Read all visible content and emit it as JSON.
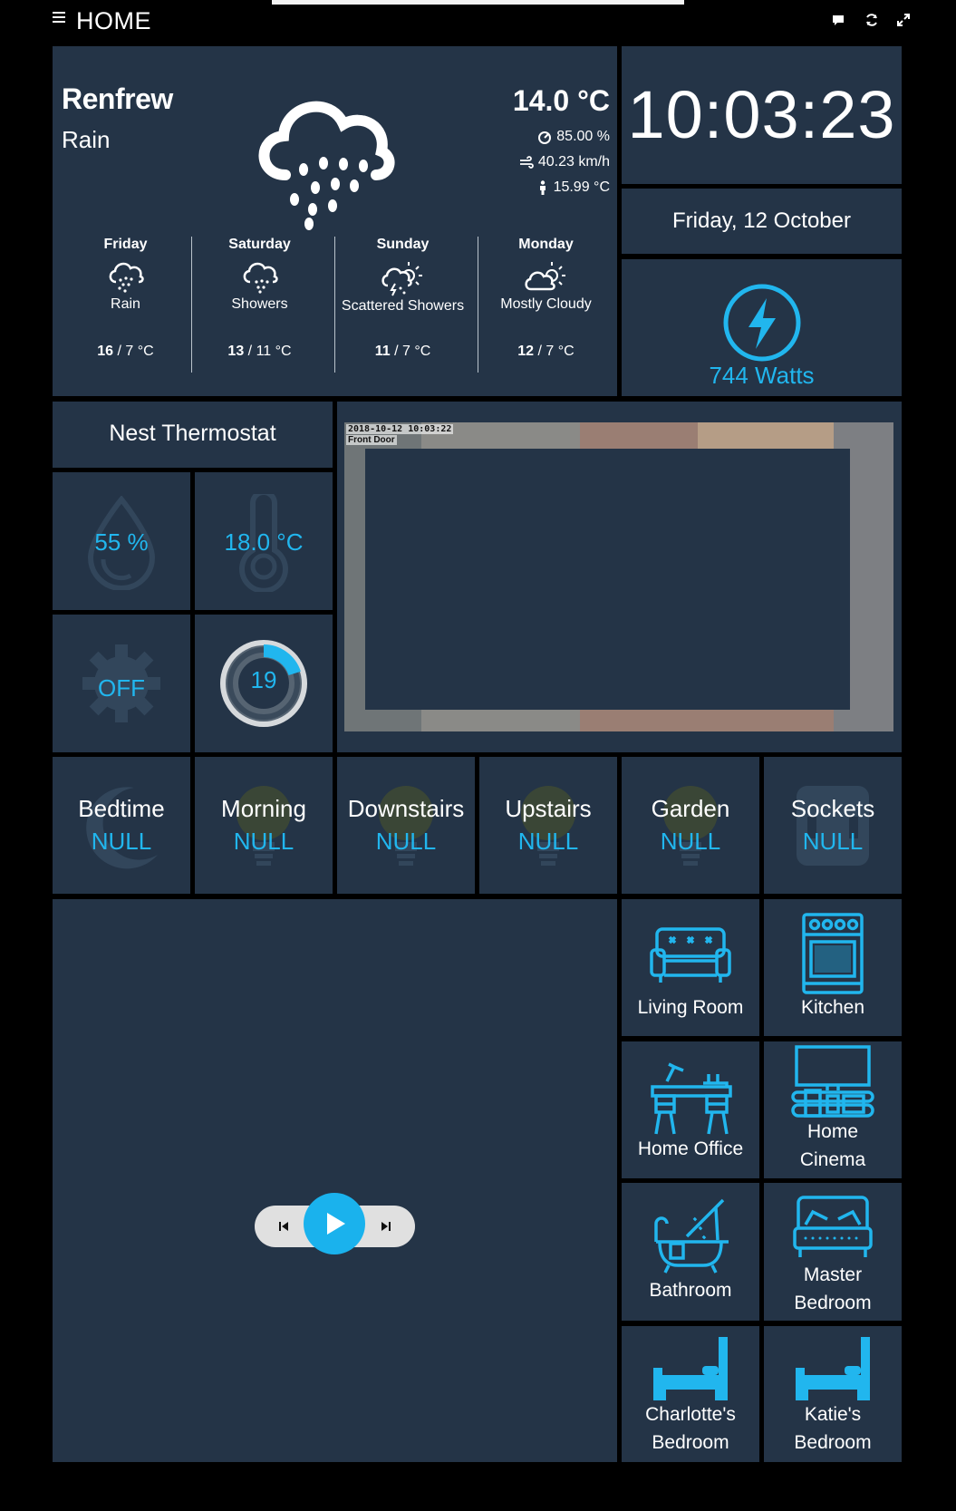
{
  "header": {
    "title": "HOME"
  },
  "weather": {
    "city": "Renfrew",
    "condition": "Rain",
    "temperature": "14.0 °C",
    "humidity": "85.00 %",
    "wind": "40.23 km/h",
    "feels_like": "15.99 °C",
    "forecast": [
      {
        "day": "Friday",
        "condition": "Rain",
        "high": "16",
        "low": "/ 7 °C",
        "icon": "rain-cloud-icon"
      },
      {
        "day": "Saturday",
        "condition": "Showers",
        "high": "13",
        "low": "/ 11 °C",
        "icon": "showers-cloud-icon"
      },
      {
        "day": "Sunday",
        "condition": "Scattered Showers",
        "high": "11",
        "low": "/ 7 °C",
        "icon": "scattered-showers-icon"
      },
      {
        "day": "Monday",
        "condition": "Mostly Cloudy",
        "high": "12",
        "low": "/ 7 °C",
        "icon": "mostly-cloudy-icon"
      }
    ]
  },
  "clock": {
    "time": "10:03:23",
    "date": "Friday, 12 October"
  },
  "power": {
    "value": "744 Watts"
  },
  "thermostat": {
    "title": "Nest Thermostat",
    "humidity": "55 %",
    "temperature": "18.0 °C",
    "mode": "OFF",
    "target": "19",
    "target_fraction": 0.2
  },
  "camera": {
    "timestamp": "2018-10-12 10:03:22",
    "name": "Front Door"
  },
  "scenes": [
    {
      "name": "Bedtime",
      "value": "NULL",
      "icon": "moon-icon"
    },
    {
      "name": "Morning",
      "value": "NULL",
      "icon": "bulb-icon"
    },
    {
      "name": "Downstairs",
      "value": "NULL",
      "icon": "bulb-icon"
    },
    {
      "name": "Upstairs",
      "value": "NULL",
      "icon": "bulb-icon"
    },
    {
      "name": "Garden",
      "value": "NULL",
      "icon": "bulb-icon"
    },
    {
      "name": "Sockets",
      "value": "NULL",
      "icon": "socket-icon"
    }
  ],
  "rooms": {
    "living_room": "Living Room",
    "kitchen": "Kitchen",
    "home_office": "Home Office",
    "home_cinema_1": "Home",
    "home_cinema_2": "Cinema",
    "bathroom": "Bathroom",
    "master_1": "Master",
    "master_2": "Bedroom",
    "charlotte_1": "Charlotte's",
    "charlotte_2": "Bedroom",
    "katie_1": "Katie's",
    "katie_2": "Bedroom"
  },
  "colors": {
    "tile": "#243447",
    "accent": "#21b6ee",
    "background": "#000000"
  }
}
